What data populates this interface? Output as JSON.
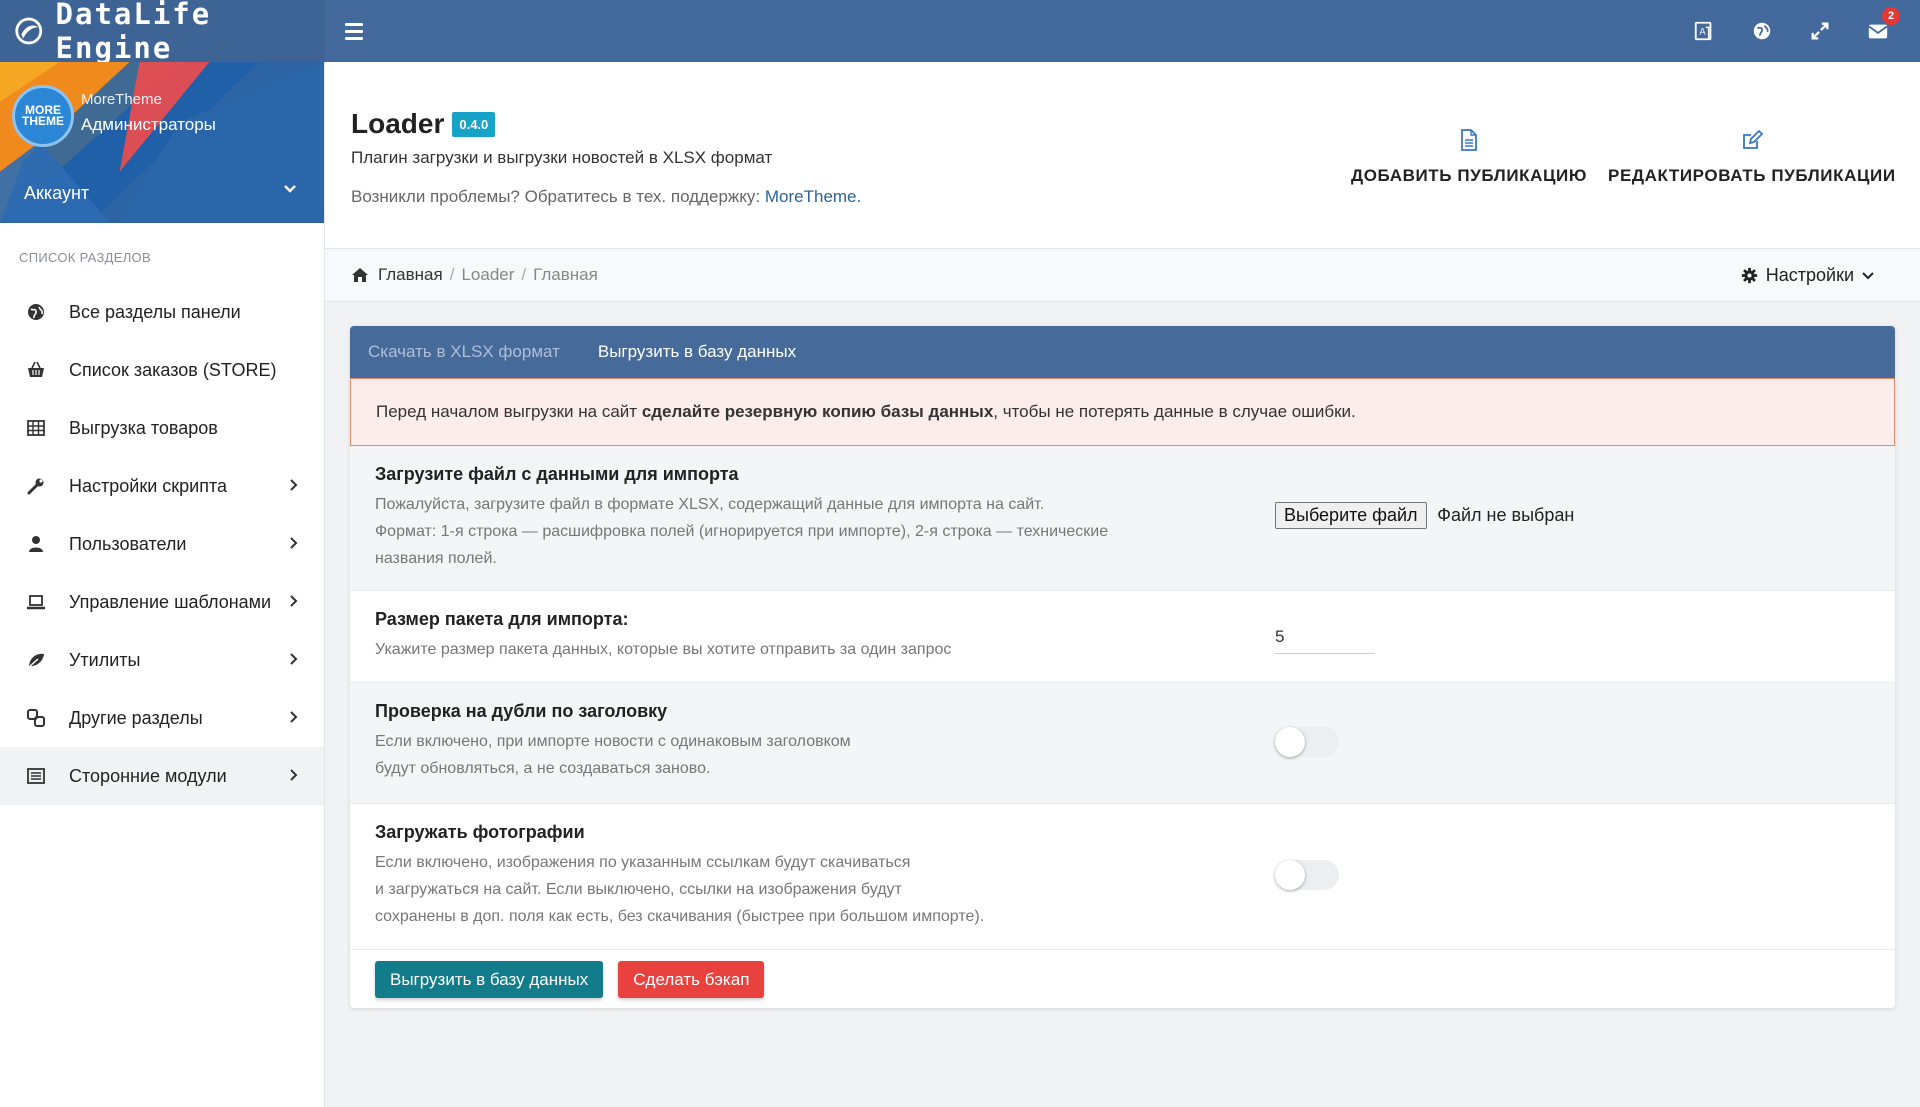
{
  "brand": {
    "name": "DataLife Engine"
  },
  "topbar": {
    "mail_badge": "2"
  },
  "profile": {
    "name": "MoreTheme",
    "role": "Администраторы",
    "avatar_text": "MORE THEME",
    "account_label": "Аккаунт"
  },
  "sidebar": {
    "section_title": "СПИСОК РАЗДЕЛОВ",
    "items": [
      {
        "label": "Все разделы панели",
        "icon": "globe-icon",
        "has_arrow": false
      },
      {
        "label": "Список заказов (STORE)",
        "icon": "basket-icon",
        "has_arrow": false
      },
      {
        "label": "Выгрузка товаров",
        "icon": "table-icon",
        "has_arrow": false
      },
      {
        "label": "Настройки скрипта",
        "icon": "wrench-icon",
        "has_arrow": true
      },
      {
        "label": "Пользователи",
        "icon": "user-icon",
        "has_arrow": true
      },
      {
        "label": "Управление шаблонами",
        "icon": "laptop-icon",
        "has_arrow": true
      },
      {
        "label": "Утилиты",
        "icon": "leaf-icon",
        "has_arrow": true
      },
      {
        "label": "Другие разделы",
        "icon": "link-icon",
        "has_arrow": true
      },
      {
        "label": "Сторонние модули",
        "icon": "list-icon",
        "has_arrow": true
      }
    ]
  },
  "header": {
    "title": "Loader",
    "version": "0.4.0",
    "subtitle": "Плагин загрузки и выгрузки новостей в XLSX формат",
    "support_text": "Возникли проблемы? Обратитесь в тех. поддержку: ",
    "support_link": "MoreTheme.",
    "add_publication": "ДОБАВИТЬ ПУБЛИКАЦИЮ",
    "edit_publications": "РЕДАКТИРОВАТЬ ПУБЛИКАЦИИ"
  },
  "breadcrumb": {
    "home": "Главная",
    "module": "Loader",
    "current": "Главная",
    "settings": "Настройки"
  },
  "tabs": {
    "download": "Скачать в XLSX формат",
    "upload": "Выгрузить в базу данных"
  },
  "alert": {
    "before": "Перед началом выгрузки на сайт ",
    "bold": "сделайте резервную копию базы данных",
    "after": ", чтобы не потерять данные в случае ошибки."
  },
  "rows": {
    "file": {
      "title": "Загрузите файл с данными для импорта",
      "desc1": "Пожалуйста, загрузите файл в формате XLSX, содержащий данные для импорта на сайт.",
      "desc2": "Формат: 1-я строка — расшифровка полей (игнорируется при импорте), 2-я строка — технические",
      "desc3": "названия полей.",
      "button": "Выберите файл",
      "status": "Файл не выбран"
    },
    "batch": {
      "title": "Размер пакета для импорта:",
      "desc1": "Укажите размер пакета данных, которые вы хотите отправить за один запрос",
      "value": "5"
    },
    "dupes": {
      "title": "Проверка на дубли по заголовку",
      "desc1": "Если включено, при импорте новости с одинаковым заголовком",
      "desc2": "будут обновляться, а не создаваться заново."
    },
    "photos": {
      "title": "Загружать фотографии",
      "desc1": "Если включено, изображения по указанным ссылкам будут скачиваться",
      "desc2": "и загружаться на сайт. Если выключено, ссылки на изображения будут",
      "desc3": "сохранены в доп. поля как есть, без скачивания (быстрее при большом импорте)."
    }
  },
  "buttons": {
    "upload": "Выгрузить в базу данных",
    "backup": "Сделать бэкап"
  },
  "colors": {
    "topbar": "#44699d",
    "tabs": "#466a9a",
    "teal": "#137c8b",
    "red": "#e9413d",
    "version": "#17a2c8"
  }
}
